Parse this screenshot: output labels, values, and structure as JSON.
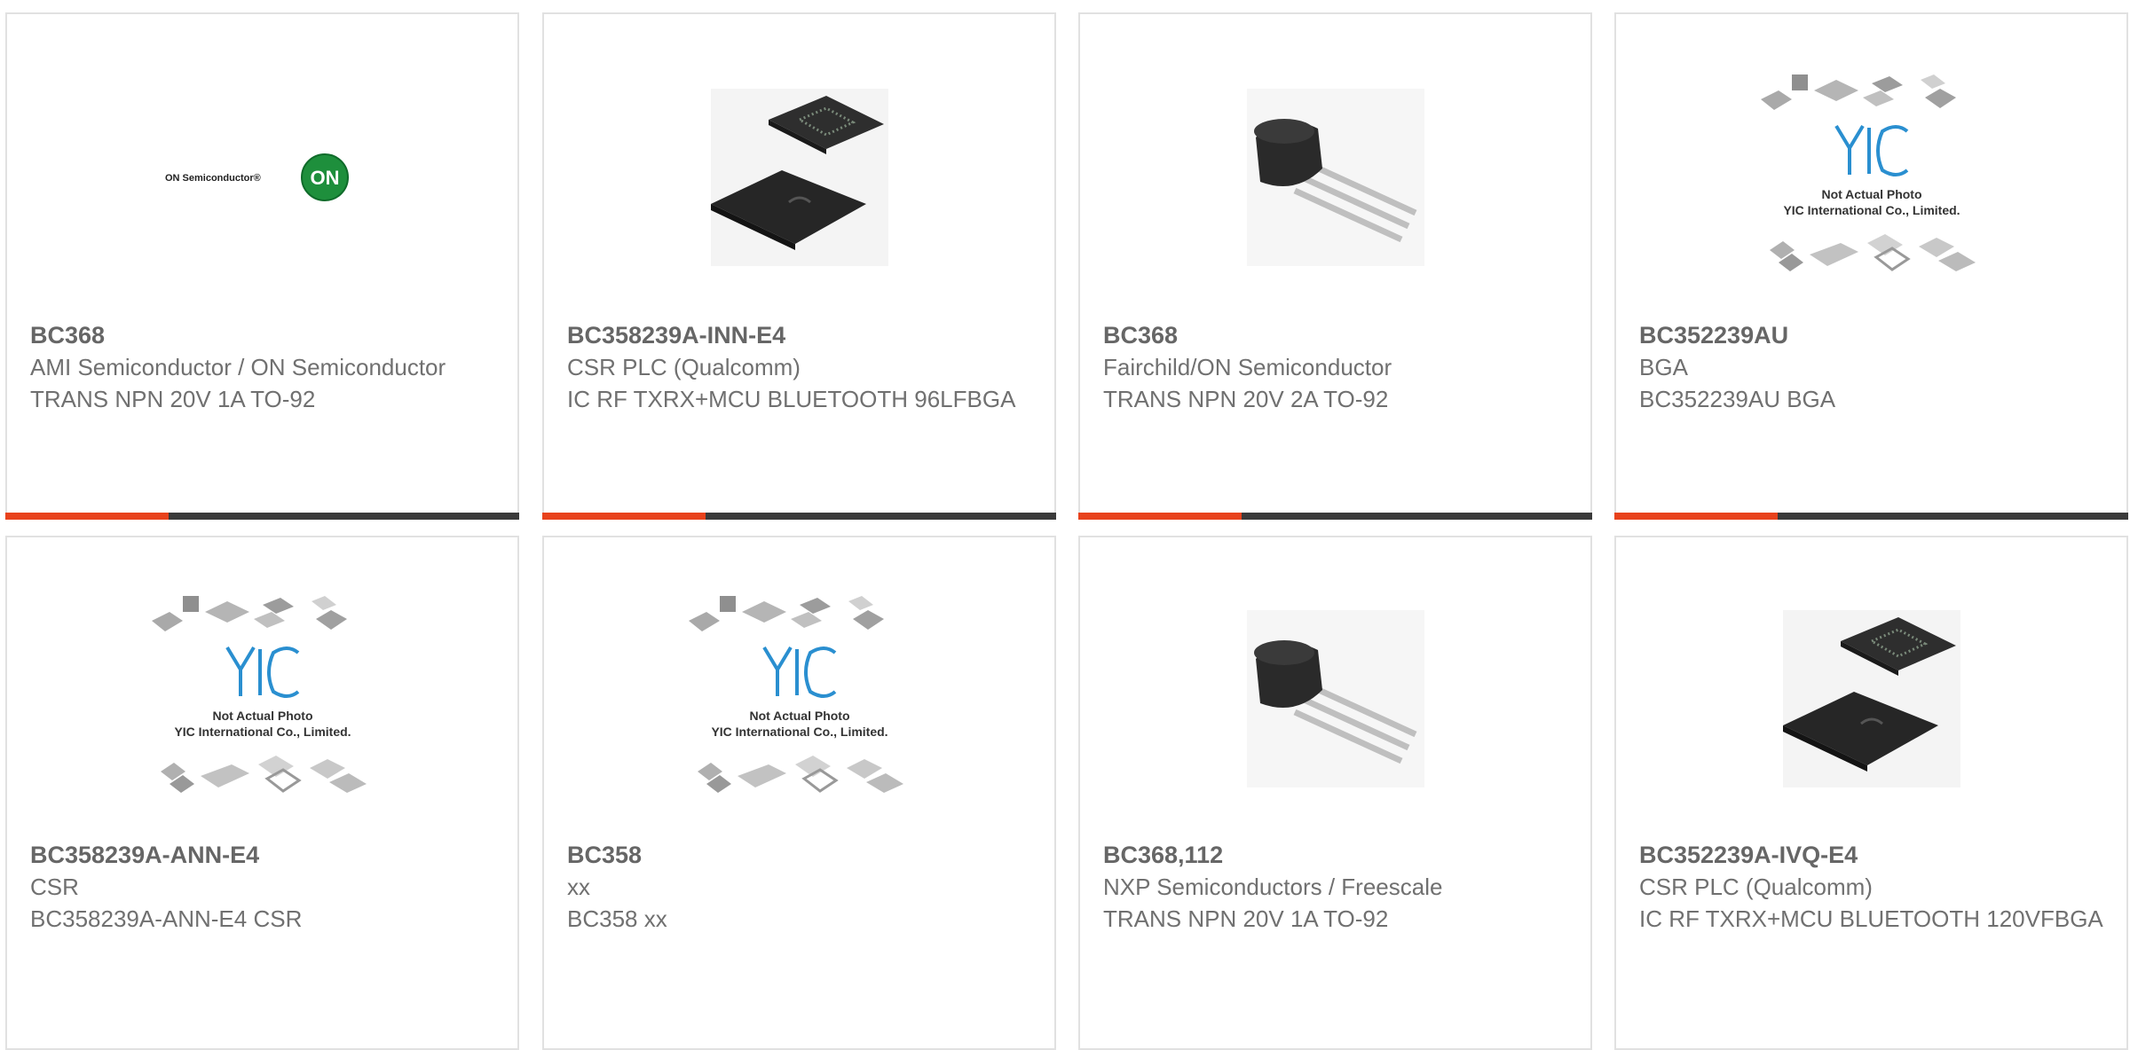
{
  "colors": {
    "accent": "#e8421c",
    "bar_dark": "#3a3a3a",
    "text": "#666666",
    "border": "#e1e1e1"
  },
  "products": [
    {
      "part": "BC368",
      "manufacturer": "AMI Semiconductor / ON Semiconductor",
      "description": "TRANS NPN 20V 1A TO-92",
      "image": "on-semiconductor-logo",
      "logo_text": "ON Semiconductor®",
      "logo_badge": "ON"
    },
    {
      "part": "BC358239A-INN-E4",
      "manufacturer": "CSR PLC (Qualcomm)",
      "description": "IC RF TXRX+MCU BLUETOOTH 96LFBGA",
      "image": "bga-chip-photo"
    },
    {
      "part": "BC368",
      "manufacturer": "Fairchild/ON Semiconductor",
      "description": "TRANS NPN 20V 2A TO-92",
      "image": "to92-transistor-photo"
    },
    {
      "part": "BC352239AU",
      "manufacturer": "BGA",
      "description": "BC352239AU BGA",
      "image": "placeholder-yic",
      "placeholder_l1": "Not Actual Photo",
      "placeholder_l2": "YIC International Co., Limited."
    },
    {
      "part": "BC358239A-ANN-E4",
      "manufacturer": "CSR",
      "description": "BC358239A-ANN-E4 CSR",
      "image": "placeholder-yic",
      "placeholder_l1": "Not Actual Photo",
      "placeholder_l2": "YIC International Co., Limited."
    },
    {
      "part": "BC358",
      "manufacturer": "xx",
      "description": "BC358 xx",
      "image": "placeholder-yic",
      "placeholder_l1": "Not Actual Photo",
      "placeholder_l2": "YIC International Co., Limited."
    },
    {
      "part": "BC368,112",
      "manufacturer": "NXP Semiconductors / Freescale",
      "description": "TRANS NPN 20V 1A TO-92",
      "image": "to92-transistor-photo"
    },
    {
      "part": "BC352239A-IVQ-E4",
      "manufacturer": "CSR PLC (Qualcomm)",
      "description": "IC RF TXRX+MCU BLUETOOTH 120VFBGA",
      "image": "bga-chip-photo"
    }
  ]
}
